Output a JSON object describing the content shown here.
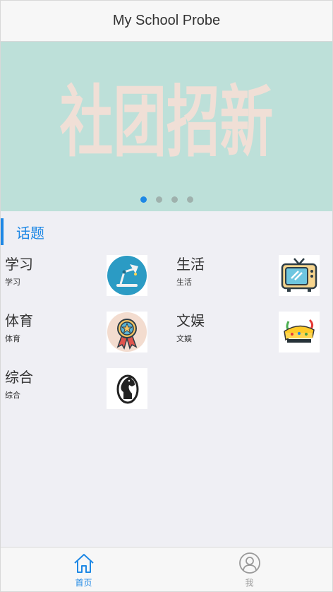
{
  "header": {
    "title": "My School Probe"
  },
  "banner": {
    "text": "社团招新",
    "background": "#bde0d9",
    "text_color": "#f3dfd6",
    "slides_total": 4,
    "active_slide": 1
  },
  "section": {
    "title": "话题",
    "accent": "#1e88e5"
  },
  "topics": [
    {
      "name": "学习",
      "sub": "学习",
      "icon": "desk-lamp-icon"
    },
    {
      "name": "生活",
      "sub": "生活",
      "icon": "tv-icon"
    },
    {
      "name": "体育",
      "sub": "体育",
      "icon": "medal-icon"
    },
    {
      "name": "文娱",
      "sub": "文娱",
      "icon": "banana-culture-logo"
    },
    {
      "name": "综合",
      "sub": "综合",
      "icon": "chess-knight-icon"
    }
  ],
  "tabbar": {
    "items": [
      {
        "label": "首页",
        "icon": "home-icon",
        "active": true
      },
      {
        "label": "我",
        "icon": "user-icon",
        "active": false
      }
    ]
  }
}
